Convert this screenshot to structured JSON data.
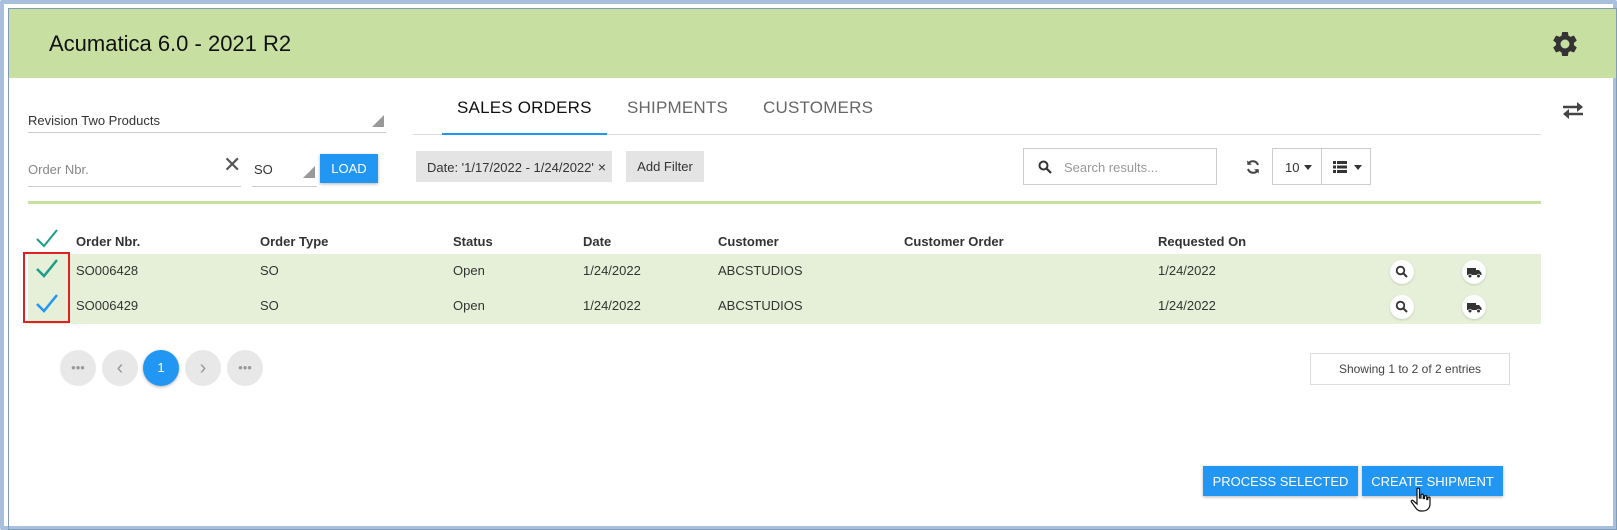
{
  "app": {
    "title": "Acumatica 6.0 - 2021 R2",
    "accent_color": "#2196f3",
    "header_color": "#c7e0a2",
    "row_highlight_color": "#e6f0d8"
  },
  "controls": {
    "profile_select": "Revision Two Products",
    "order_number": {
      "placeholder": "Order Nbr.",
      "value": ""
    },
    "order_type": "SO",
    "load_label": "LOAD"
  },
  "tabs": [
    {
      "label": "SALES ORDERS",
      "active": true
    },
    {
      "label": "SHIPMENTS",
      "active": false
    },
    {
      "label": "CUSTOMERS",
      "active": false
    }
  ],
  "filters": {
    "date_chip": "Date: '1/17/2022 - 1/24/2022'",
    "chip_remove": "×",
    "add_filter_label": "Add Filter"
  },
  "search": {
    "placeholder": "Search results...",
    "value": ""
  },
  "page_size": "10",
  "table": {
    "columns": [
      "Order Nbr.",
      "Order Type",
      "Status",
      "Date",
      "Customer",
      "Customer Order",
      "Requested On"
    ],
    "rows": [
      {
        "selected": true,
        "order_nbr": "SO006428",
        "order_type": "SO",
        "status": "Open",
        "date": "1/24/2022",
        "customer": "ABCSTUDIOS",
        "customer_order": "",
        "requested_on": "1/24/2022"
      },
      {
        "selected": true,
        "order_nbr": "SO006429",
        "order_type": "SO",
        "status": "Open",
        "date": "1/24/2022",
        "customer": "ABCSTUDIOS",
        "customer_order": "",
        "requested_on": "1/24/2022"
      }
    ]
  },
  "pager": {
    "first": "•••",
    "prev": "‹",
    "current": "1",
    "next": "›",
    "last": "•••",
    "summary": "Showing 1 to 2 of 2 entries"
  },
  "actions": {
    "process_selected": "PROCESS SELECTED",
    "create_shipment": "CREATE SHIPMENT"
  },
  "icons": {
    "settings": "gear-icon",
    "swap": "swap-arrows-icon",
    "search": "search-icon",
    "refresh": "refresh-icon",
    "list_view": "list-view-icon",
    "row_view": "magnifier-icon",
    "row_ship": "truck-icon",
    "select_all": "checkmark-icon",
    "cursor": "hand-pointer-icon"
  }
}
